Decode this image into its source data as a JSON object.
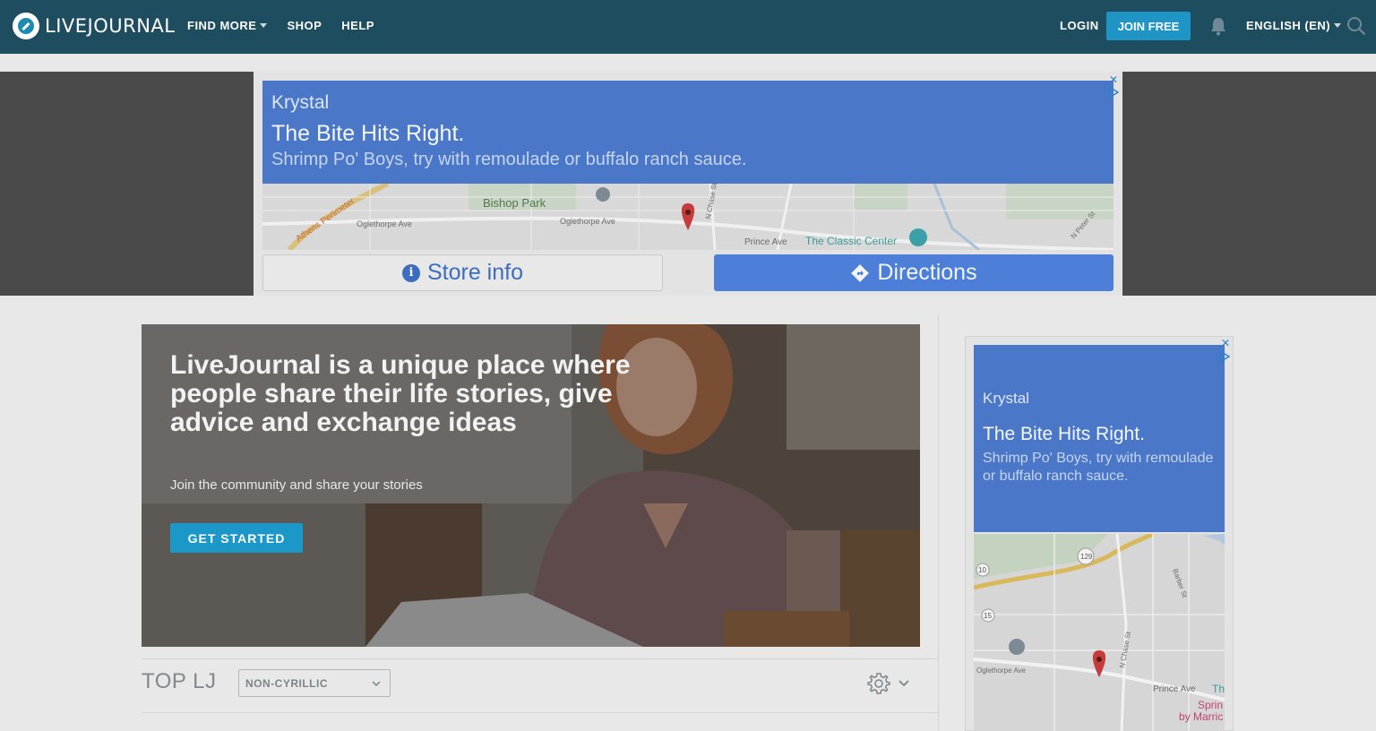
{
  "header": {
    "logo_text": "LIVEJOURNAL",
    "nav": [
      {
        "label": "FIND MORE",
        "has_dropdown": true
      },
      {
        "label": "SHOP",
        "has_dropdown": false
      },
      {
        "label": "HELP",
        "has_dropdown": false
      }
    ],
    "login_label": "LOGIN",
    "join_label": "JOIN FREE",
    "language_label": "ENGLISH (EN)",
    "icons": [
      "bell-icon",
      "search-icon"
    ]
  },
  "banner_ad": {
    "brand": "Krystal",
    "headline": "The Bite Hits Right.",
    "subtext": "Shrimp Po' Boys, try with remoulade or buffalo ranch sauce.",
    "map_labels": {
      "perimeter": "Athens Perimeter",
      "oglethorpe_1": "Oglethorpe Ave",
      "bishop_park": "Bishop Park",
      "oglethorpe_2": "Oglethorpe Ave",
      "n_chase": "N Chase St",
      "prince": "Prince Ave",
      "classic_center": "The Classic Center",
      "n_peter": "N Peter St"
    },
    "store_info_label": "Store info",
    "directions_label": "Directions",
    "colors": {
      "ad_blue": "#4a77c8",
      "button_blue": "#4d7fd8"
    }
  },
  "hero": {
    "title": "LiveJournal is a unique place where people share their life stories, give advice and exchange ideas",
    "subtitle": "Join the community and share your stories",
    "cta_label": "GET STARTED"
  },
  "top_lj": {
    "title": "TOP LJ",
    "filter_value": "NON-CYRILLIC"
  },
  "side_ad": {
    "brand": "Krystal",
    "headline": "The Bite Hits Right.",
    "subtext": "Shrimp Po' Boys, try with remoulade or buffalo ranch sauce.",
    "map_labels": {
      "route_129": "129",
      "route_10": "10",
      "route_15": "15",
      "barber": "Barber St",
      "oglethorpe": "Oglethorpe Ave",
      "n_chase": "N Chase St",
      "prince": "Prince Ave",
      "th": "Th",
      "spring": "Sprin",
      "by_marri": "by Marric"
    }
  }
}
